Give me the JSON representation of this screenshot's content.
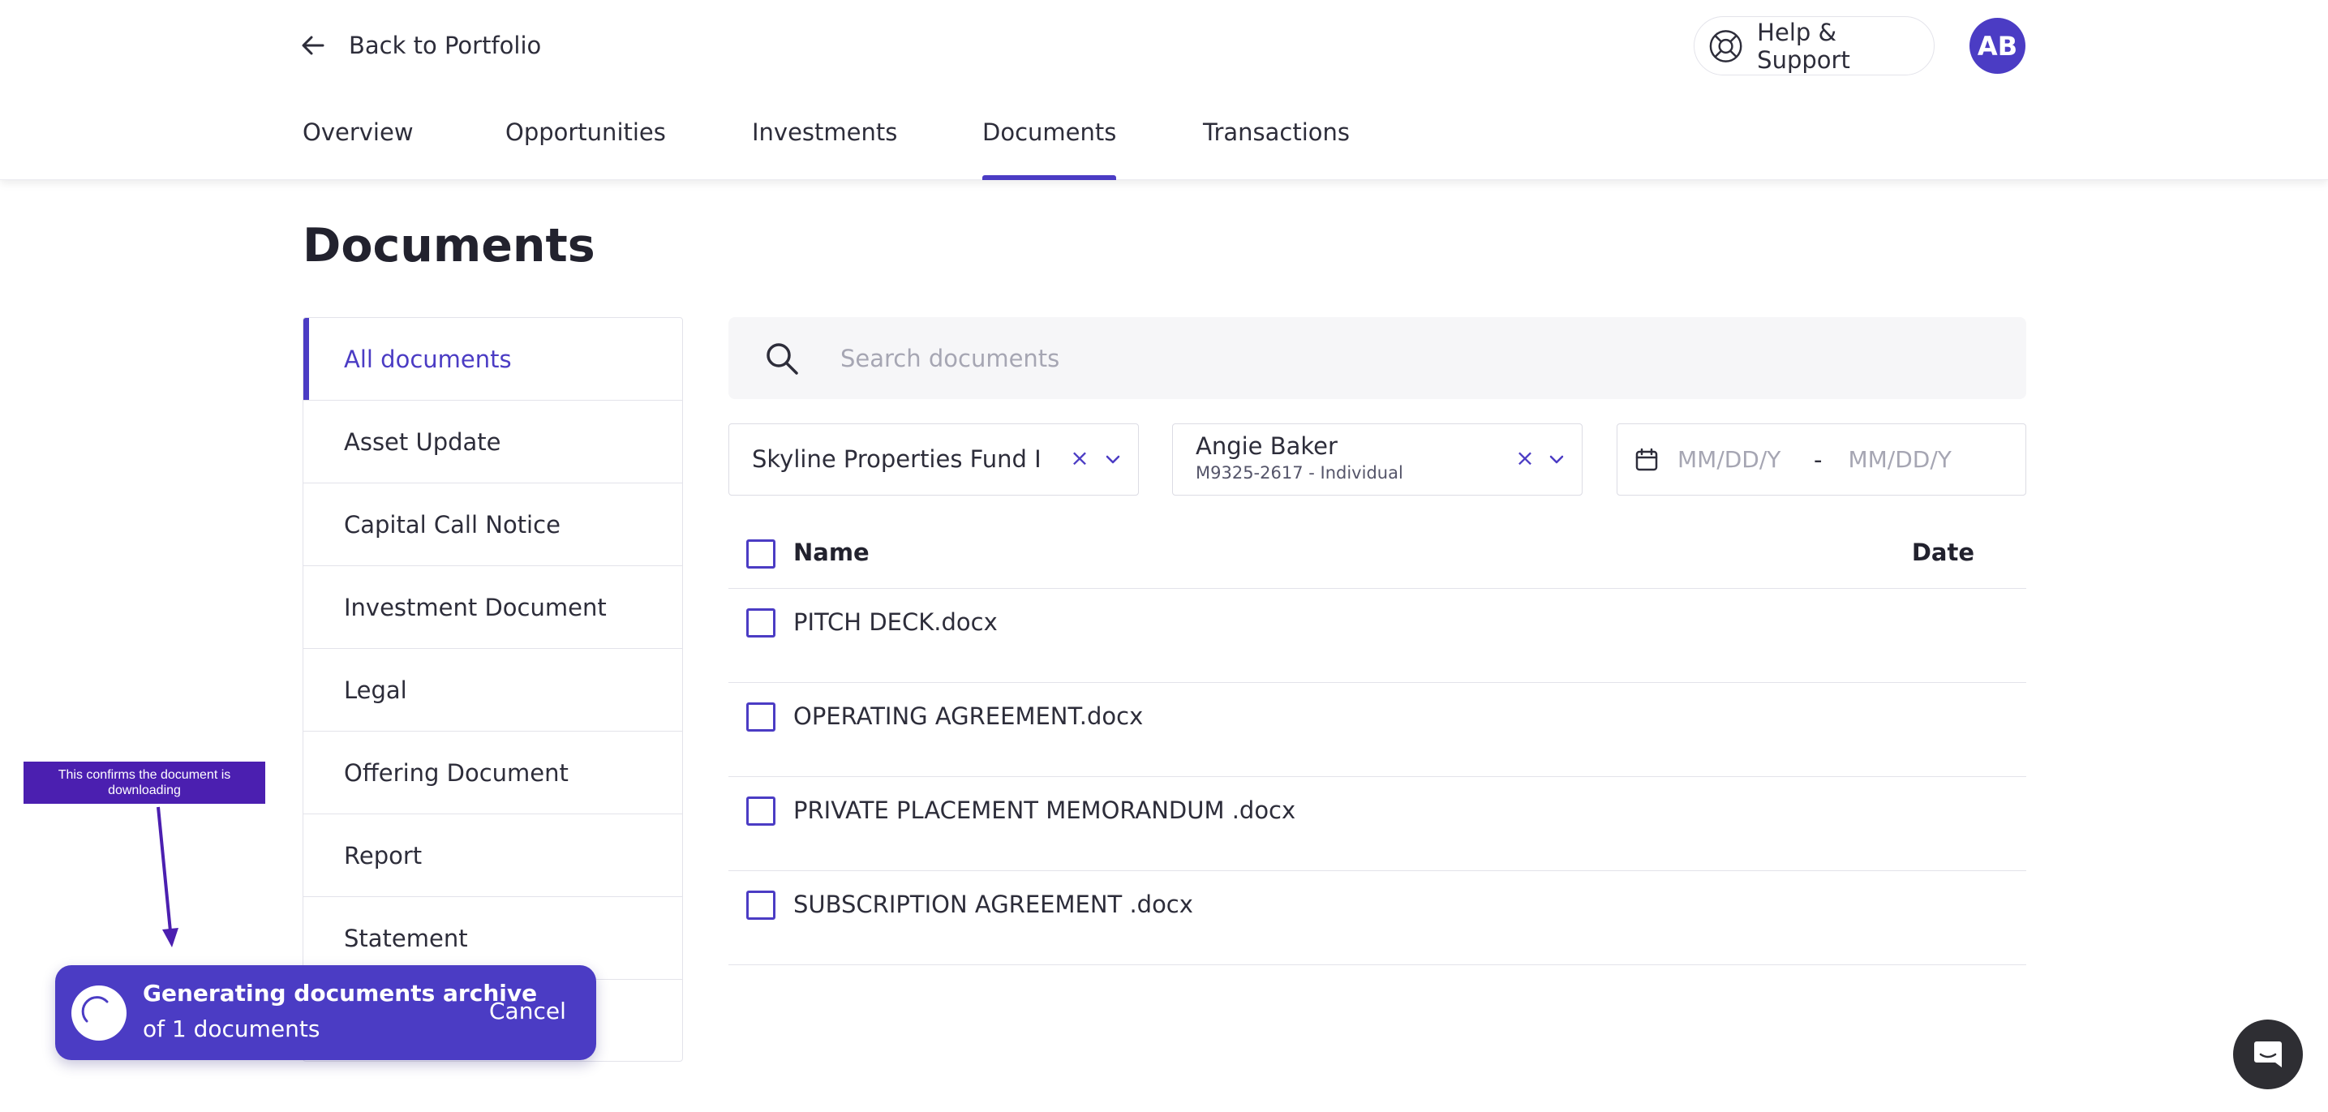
{
  "header": {
    "back_label": "Back to Portfolio",
    "help_label": "Help & Support",
    "avatar_initials": "AB",
    "tabs": [
      {
        "label": "Overview"
      },
      {
        "label": "Opportunities"
      },
      {
        "label": "Investments"
      },
      {
        "label": "Documents",
        "active": true
      },
      {
        "label": "Transactions"
      }
    ]
  },
  "page": {
    "title": "Documents"
  },
  "sidebar": {
    "items": [
      {
        "label": "All documents",
        "active": true
      },
      {
        "label": "Asset Update"
      },
      {
        "label": "Capital Call Notice"
      },
      {
        "label": "Investment Document"
      },
      {
        "label": "Legal"
      },
      {
        "label": "Offering Document"
      },
      {
        "label": "Report"
      },
      {
        "label": "Statement"
      }
    ]
  },
  "search": {
    "placeholder": "Search documents",
    "value": ""
  },
  "filters": {
    "fund": {
      "value": "Skyline Properties Fund I",
      "clear": "×"
    },
    "investor": {
      "value": "Angie Baker",
      "sub": "M9325-2617 - Individual",
      "clear": "×"
    },
    "date_range": {
      "start_placeholder": "MM/DD/Y",
      "separator": "-",
      "end_placeholder": "MM/DD/Y"
    }
  },
  "table": {
    "columns": {
      "name": "Name",
      "date": "Date"
    },
    "rows": [
      {
        "name": "PITCH DECK.docx",
        "date": ""
      },
      {
        "name": "OPERATING AGREEMENT.docx",
        "date": ""
      },
      {
        "name": "PRIVATE PLACEMENT MEMORANDUM .docx",
        "date": ""
      },
      {
        "name": "SUBSCRIPTION AGREEMENT .docx",
        "date": ""
      }
    ]
  },
  "annotation": {
    "text": "This confirms the document is downloading"
  },
  "toast": {
    "title": "Generating documents archive",
    "subtitle": "of 1 documents",
    "cancel_label": "Cancel"
  },
  "icons": {
    "back": "arrow-left-icon",
    "help": "lifebuoy-icon",
    "search": "search-icon",
    "calendar": "calendar-icon",
    "chevron": "chevron-down-icon",
    "chat": "chat-icon",
    "spinner": "spinner-icon"
  },
  "colors": {
    "accent": "#4b3cc4",
    "annotation_bg": "#4b1fb0",
    "chat_bg": "#2e2e33",
    "text": "#2d2d3a",
    "placeholder": "#a6a6b3"
  }
}
